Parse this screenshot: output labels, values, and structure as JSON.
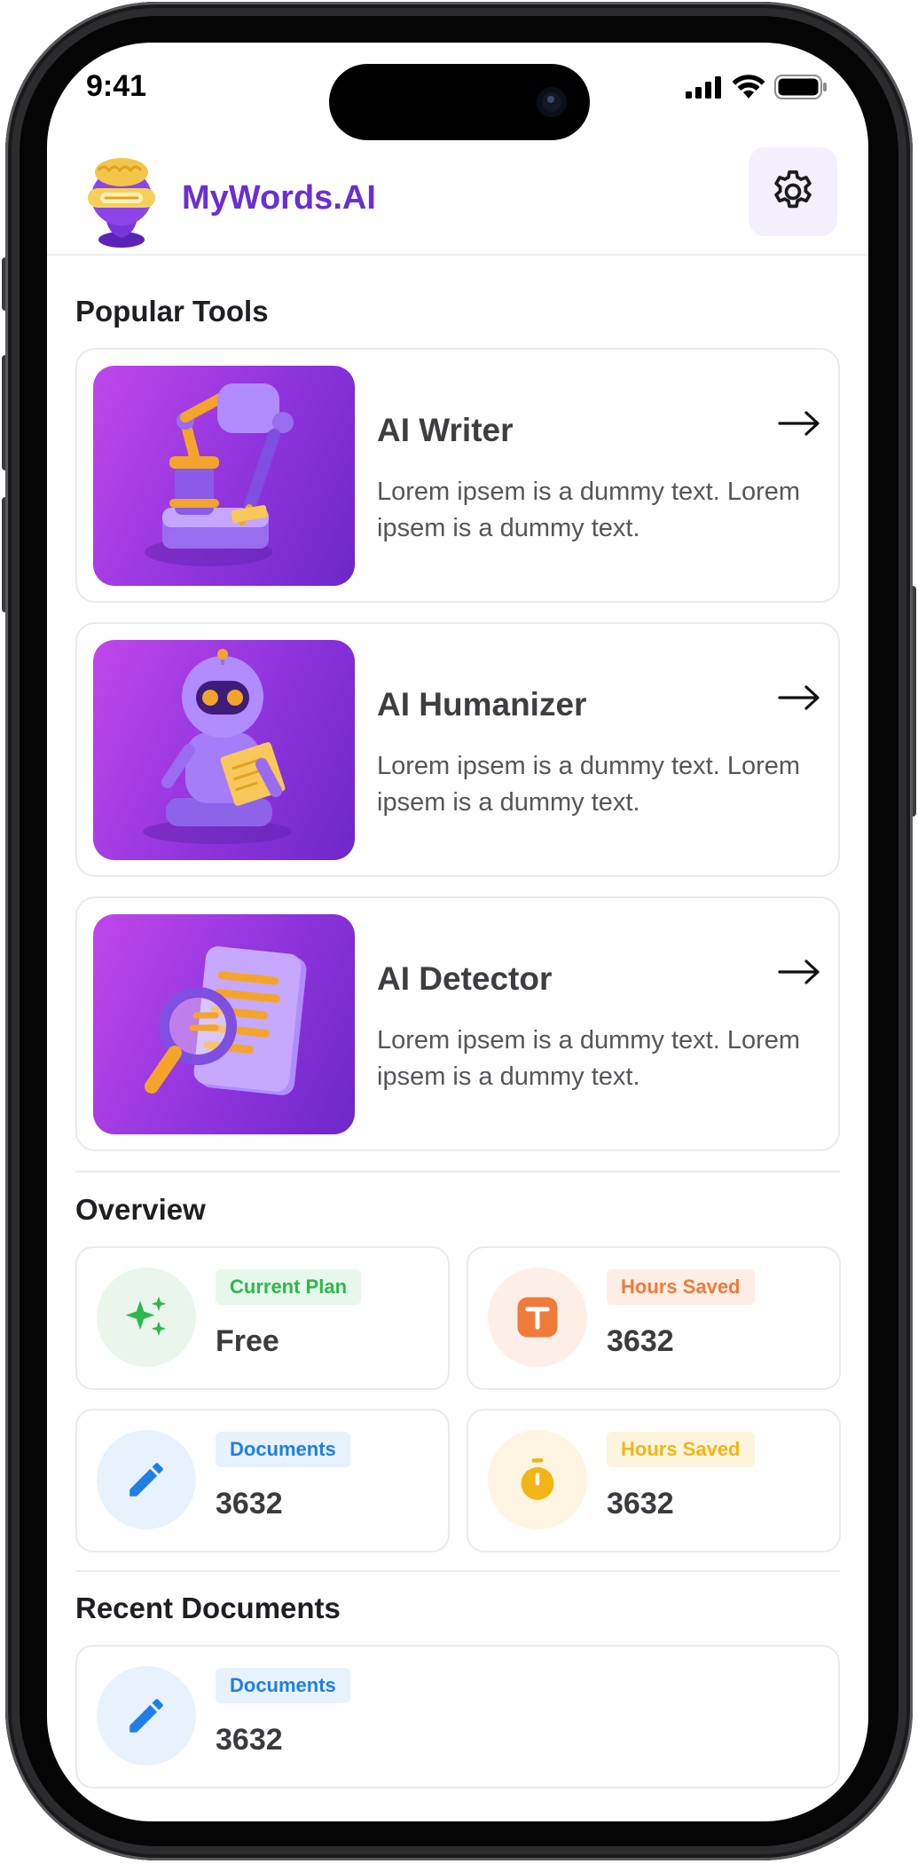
{
  "status": {
    "time": "9:41"
  },
  "header": {
    "app_name": "MyWords.AI"
  },
  "popular": {
    "title": "Popular Tools",
    "tools": [
      {
        "title": "AI Writer",
        "description": "Lorem ipsem is a dummy text. Lorem ipsem is a dummy text.",
        "icon": "robot-arm-pen-icon"
      },
      {
        "title": "AI Humanizer",
        "description": "Lorem ipsem is a dummy text. Lorem ipsem is a dummy text.",
        "icon": "robot-reading-icon"
      },
      {
        "title": "AI Detector",
        "description": "Lorem ipsem is a dummy text. Lorem ipsem is a dummy text.",
        "icon": "document-magnifier-icon"
      }
    ]
  },
  "overview": {
    "title": "Overview",
    "cards": [
      {
        "label": "Current Plan",
        "value": "Free",
        "icon": "sparkles-icon",
        "accent": "#2db84d",
        "badge_bg": "#e8f7eb",
        "icon_bg": "#eaf6ec"
      },
      {
        "label": "Hours Saved",
        "value": "3632",
        "icon": "text-square-icon",
        "accent": "#f07a3a",
        "badge_bg": "#fdeee5",
        "icon_bg": "#fdefe7"
      },
      {
        "label": "Documents",
        "value": "3632",
        "icon": "pencil-icon",
        "accent": "#1f7fe6",
        "badge_bg": "#e8f2fd",
        "icon_bg": "#e8f2fd"
      },
      {
        "label": "Hours Saved",
        "value": "3632",
        "icon": "stopwatch-icon",
        "accent": "#f2b516",
        "badge_bg": "#fdf4de",
        "icon_bg": "#fdf5e2"
      }
    ]
  },
  "recent": {
    "title": "Recent Documents",
    "items": [
      {
        "label": "Documents",
        "value": "3632",
        "icon": "pencil-icon",
        "accent": "#1f7fe6"
      }
    ]
  },
  "colors": {
    "brand": "#6a2fd3",
    "tool_gradient_start": "#c047ea",
    "tool_gradient_end": "#6e27c9"
  }
}
